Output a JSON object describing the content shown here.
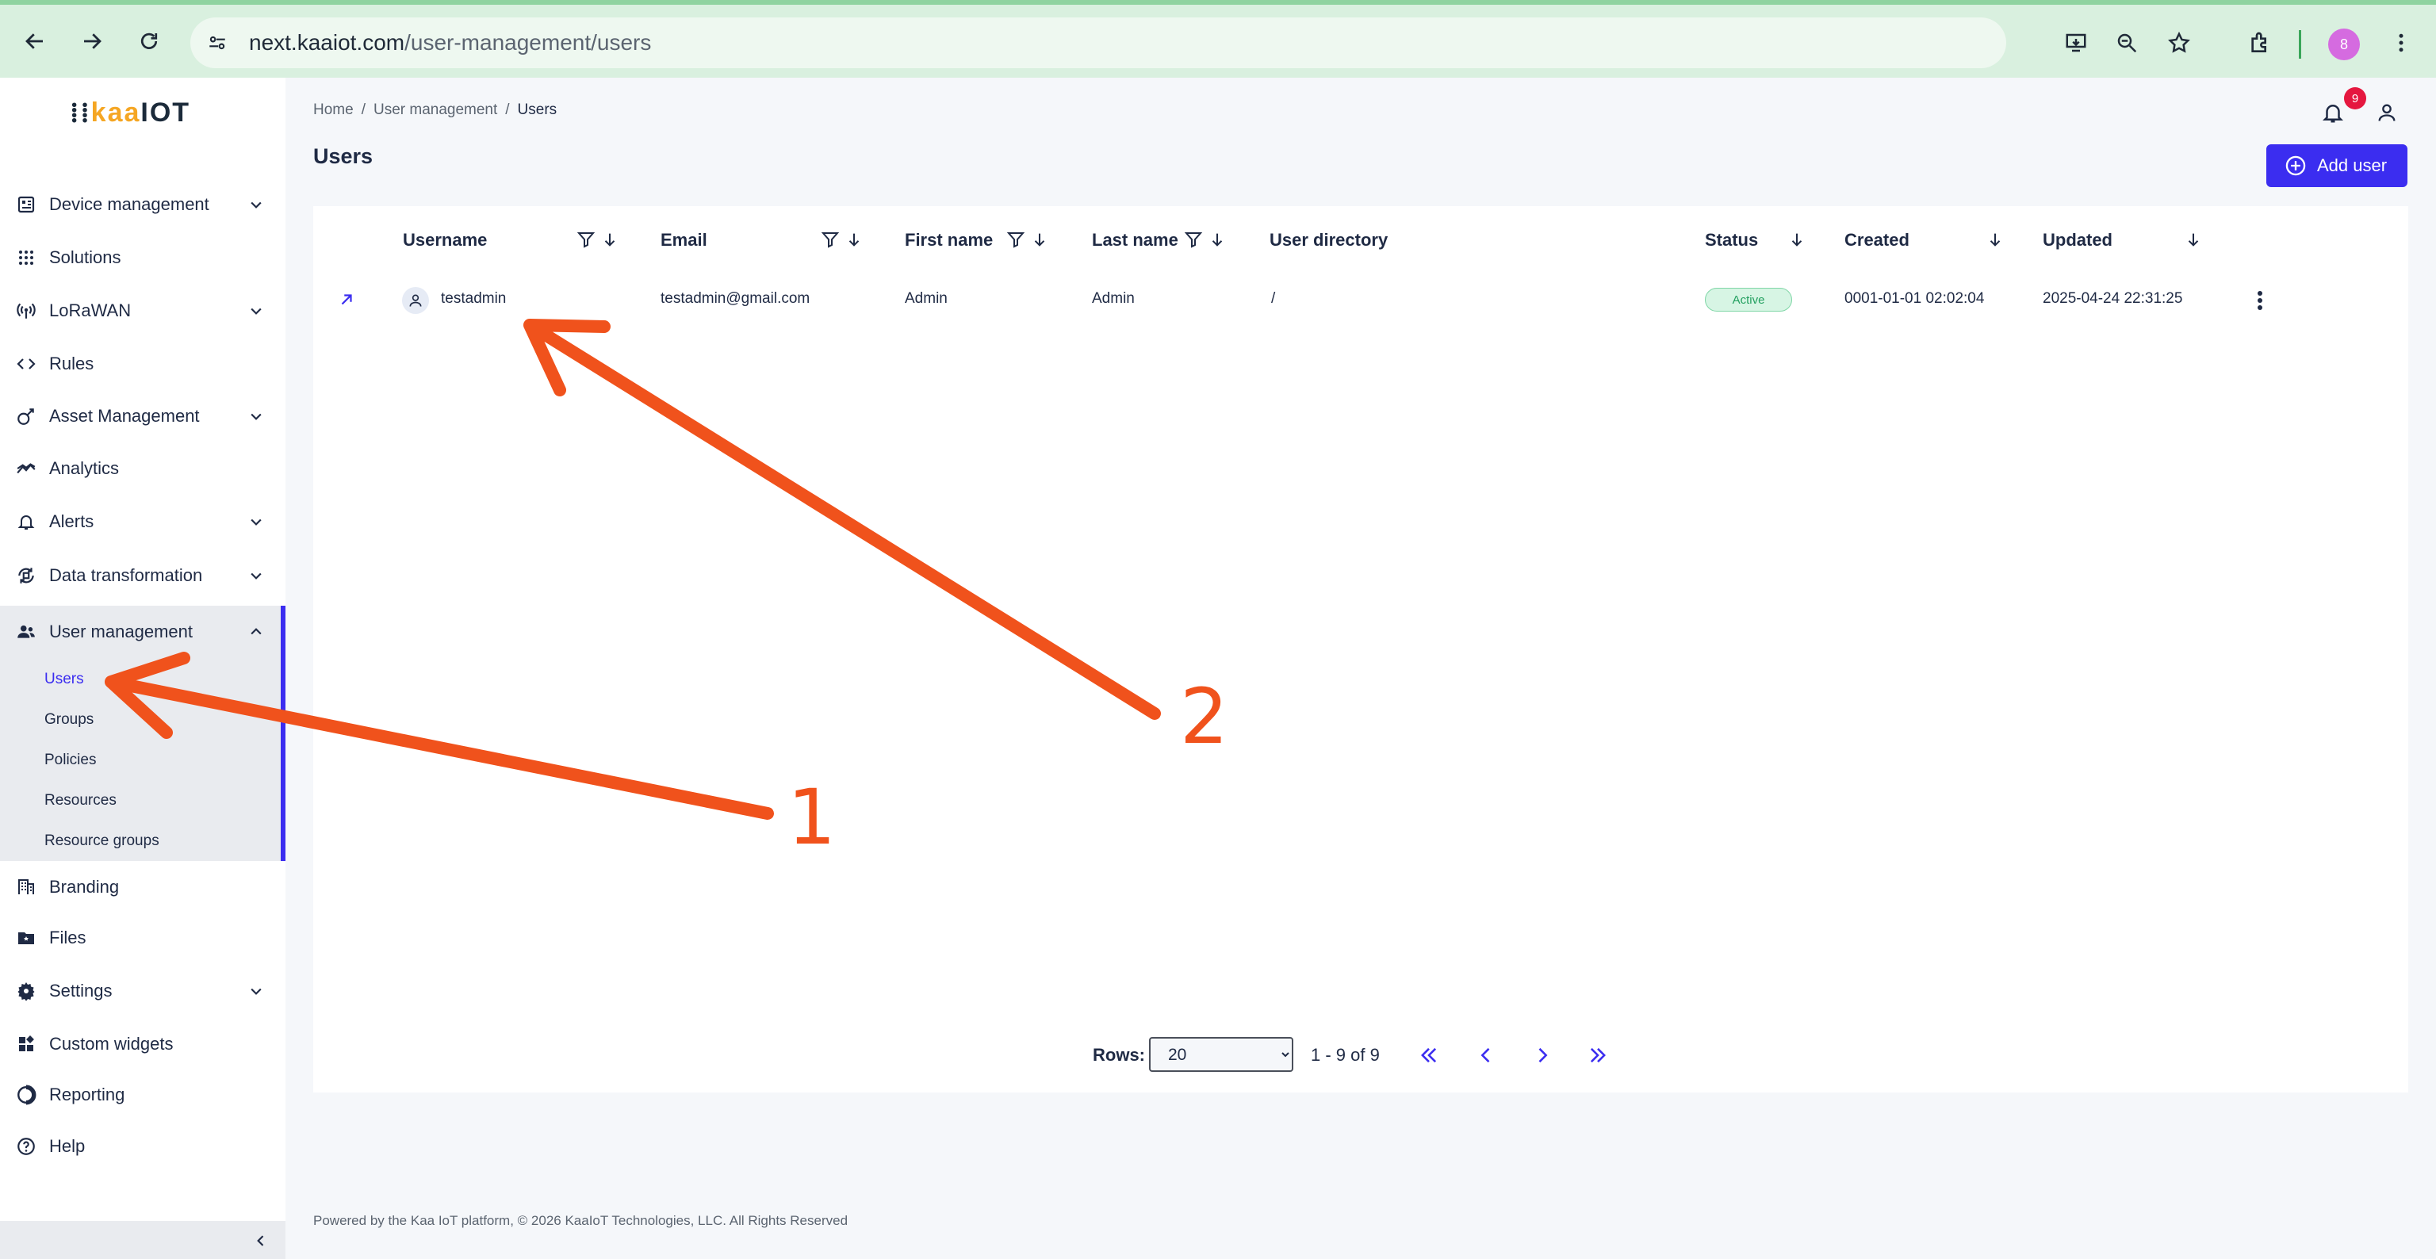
{
  "browser": {
    "url_host": "next.kaaiot.com",
    "url_path": "/user-management/users",
    "profile_initial": "8"
  },
  "logo": {
    "part1": "⁞⁞",
    "part2": "kaa",
    "part3": "IOT"
  },
  "sidebar": {
    "items": [
      {
        "label": "Device management",
        "icon": "devices-icon",
        "expandable": true
      },
      {
        "label": "Solutions",
        "icon": "grid-icon",
        "expandable": false
      },
      {
        "label": "LoRaWAN",
        "icon": "antenna-icon",
        "expandable": true
      },
      {
        "label": "Rules",
        "icon": "code-icon",
        "expandable": false
      },
      {
        "label": "Asset Management",
        "icon": "asset-icon",
        "expandable": true
      },
      {
        "label": "Analytics",
        "icon": "chart-icon",
        "expandable": false
      },
      {
        "label": "Alerts",
        "icon": "bell-icon",
        "expandable": true
      },
      {
        "label": "Data transformation",
        "icon": "transform-icon",
        "expandable": true
      },
      {
        "label": "User management",
        "icon": "users-icon",
        "expandable": true
      },
      {
        "label": "Branding",
        "icon": "building-icon",
        "expandable": false
      },
      {
        "label": "Files",
        "icon": "folder-icon",
        "expandable": false
      },
      {
        "label": "Settings",
        "icon": "gear-icon",
        "expandable": true
      },
      {
        "label": "Custom widgets",
        "icon": "widgets-icon",
        "expandable": false
      },
      {
        "label": "Reporting",
        "icon": "report-icon",
        "expandable": false
      },
      {
        "label": "Help",
        "icon": "help-icon",
        "expandable": false
      }
    ],
    "user_management_sub": [
      "Users",
      "Groups",
      "Policies",
      "Resources",
      "Resource groups"
    ],
    "active_sub": "Users"
  },
  "breadcrumb": [
    "Home",
    "User management",
    "Users"
  ],
  "page_title": "Users",
  "notifications_count": "9",
  "add_user_label": "Add user",
  "table": {
    "columns": [
      "Username",
      "Email",
      "First name",
      "Last name",
      "User directory",
      "Status",
      "Created",
      "Updated"
    ],
    "rows": [
      {
        "username": "testadmin",
        "email": "testadmin@gmail.com",
        "first_name": "Admin",
        "last_name": "Admin",
        "user_directory": "/",
        "status": "Active",
        "created": "0001-01-01 02:02:04",
        "updated": "2025-04-24 22:31:25"
      }
    ]
  },
  "pagination": {
    "rows_label": "Rows:",
    "rows_value": "20",
    "range": "1 - 9 of 9"
  },
  "footer": "Powered by the Kaa IoT platform, © 2026 KaaIoT Technologies, LLC. All Rights Reserved",
  "annotations": {
    "n1": "1",
    "n2": "2",
    "color": "#f0521c"
  },
  "colors": {
    "accent": "#3b2df0",
    "status_active": "#23a060",
    "badge": "#e5173f"
  }
}
